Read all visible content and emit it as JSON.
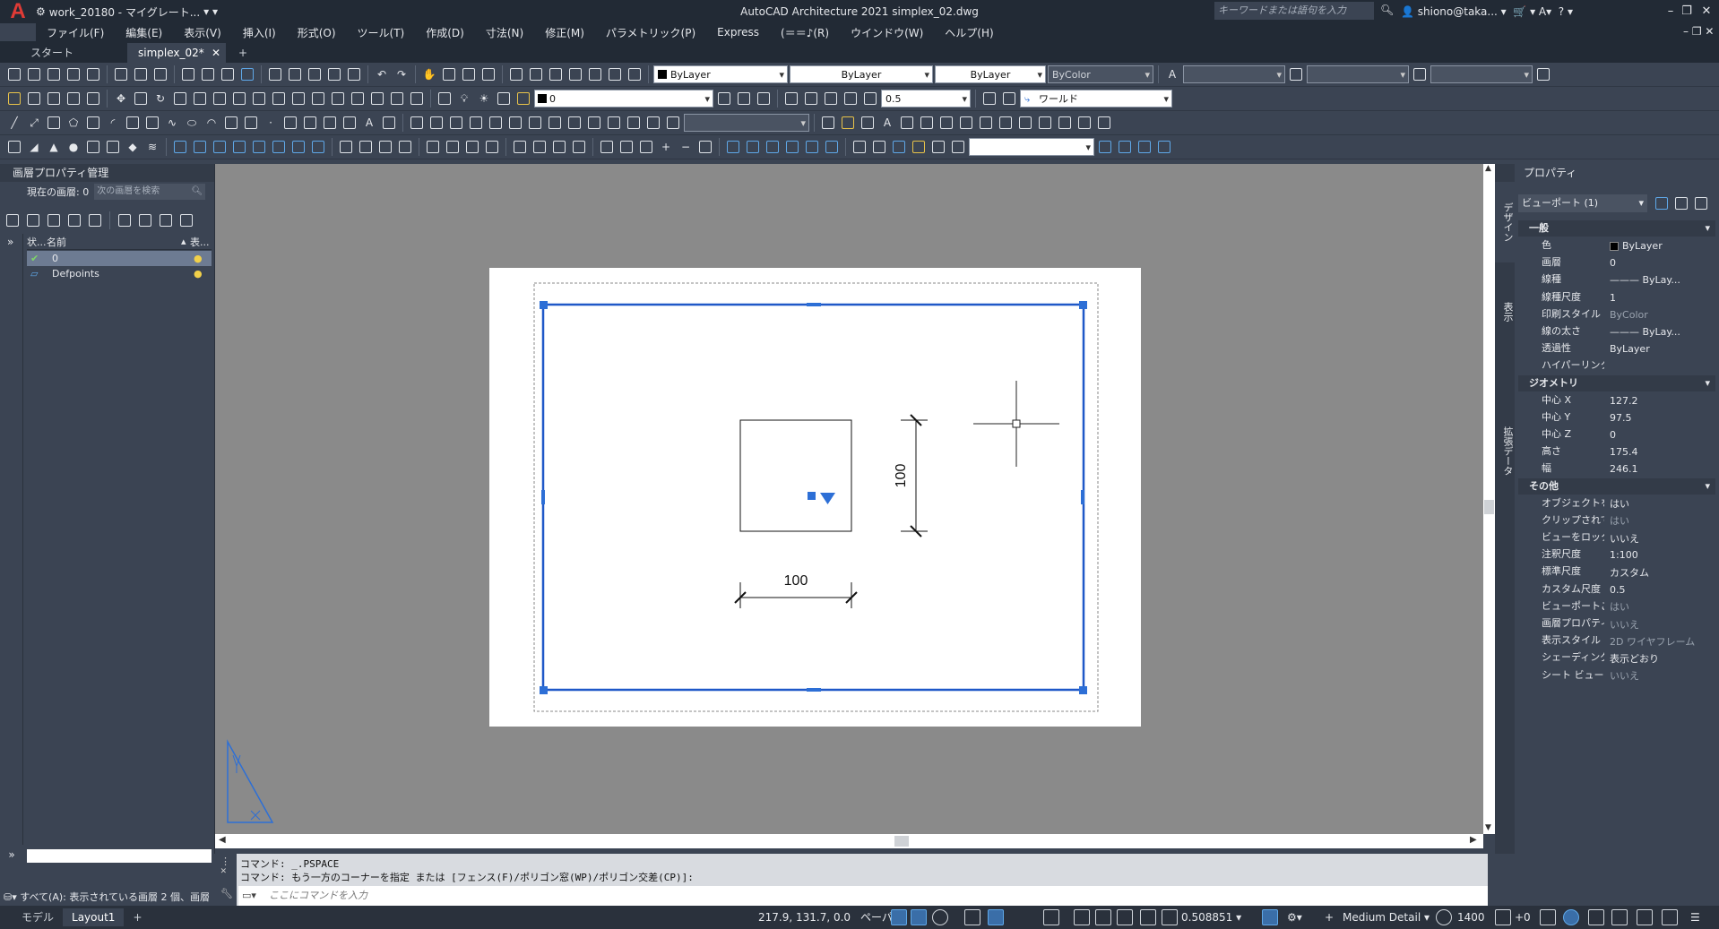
{
  "titlebar": {
    "workspace": "work_20180 - マイグレート...",
    "app_title": "AutoCAD Architecture 2021   simplex_02.dwg",
    "search_placeholder": "キーワードまたは語句を入力",
    "user": "shiono@taka..."
  },
  "menu": [
    "ファイル(F)",
    "編集(E)",
    "表示(V)",
    "挿入(I)",
    "形式(O)",
    "ツール(T)",
    "作成(D)",
    "寸法(N)",
    "修正(M)",
    "パラメトリック(P)",
    "Express",
    "(＝＝♪(R)",
    "ウインドウ(W)",
    "ヘルプ(H)"
  ],
  "tabs": {
    "start": "スタート",
    "doc": "simplex_02*",
    "add": "+"
  },
  "toolbar": {
    "color_combo": "ByLayer",
    "linetype_combo": "ByLayer",
    "lineweight_combo": "ByLayer",
    "plotstyle_combo": "ByColor",
    "layer_combo": "0",
    "scale_combo": "0.5",
    "ucs_combo": "ワールド"
  },
  "layer_panel": {
    "title": "画層プロパティ管理",
    "current_label": "現在の画層: 0",
    "search_placeholder": "次の画層を検索",
    "col_status": "状...",
    "col_name": "名前",
    "col_display": "表...",
    "layers": [
      {
        "name": "0"
      },
      {
        "name": "Defpoints"
      }
    ],
    "filter_status": "すべて(A): 表示されている画層 2 個、画層"
  },
  "drawing": {
    "dim_horizontal": "100",
    "dim_vertical": "100"
  },
  "properties": {
    "title": "プロパティ",
    "selection": "ビューポート (1)",
    "side_tabs": [
      "デザイン",
      "表示",
      "拡張データ"
    ],
    "sections": [
      {
        "title": "一般",
        "rows": [
          {
            "k": "色",
            "v": "ByLayer",
            "swatch": true
          },
          {
            "k": "画層",
            "v": "0"
          },
          {
            "k": "線種",
            "v": "——— ByLay..."
          },
          {
            "k": "線種尺度",
            "v": "1"
          },
          {
            "k": "印刷スタイル",
            "v": "ByColor",
            "dim": true
          },
          {
            "k": "線の太さ",
            "v": "——— ByLay..."
          },
          {
            "k": "透過性",
            "v": "ByLayer"
          },
          {
            "k": "ハイパーリンク",
            "v": ""
          }
        ]
      },
      {
        "title": "ジオメトリ",
        "rows": [
          {
            "k": "中心 X",
            "v": "127.2"
          },
          {
            "k": "中心 Y",
            "v": "97.5"
          },
          {
            "k": "中心 Z",
            "v": "0"
          },
          {
            "k": "高さ",
            "v": "175.4"
          },
          {
            "k": "幅",
            "v": "246.1"
          }
        ]
      },
      {
        "title": "その他",
        "rows": [
          {
            "k": "オブジェクトを表示",
            "v": "はい"
          },
          {
            "k": "クリップされている",
            "v": "はい",
            "dim": true
          },
          {
            "k": "ビューをロック",
            "v": "いいえ"
          },
          {
            "k": "注釈尺度",
            "v": "1:100"
          },
          {
            "k": "標準尺度",
            "v": "カスタム"
          },
          {
            "k": "カスタム尺度",
            "v": "0.5"
          },
          {
            "k": "ビューポートごとの...",
            "v": "はい",
            "dim": true
          },
          {
            "k": "画層プロパティの...",
            "v": "いいえ",
            "dim": true
          },
          {
            "k": "表示スタイル",
            "v": "2D ワイヤフレーム",
            "dim": true
          },
          {
            "k": "シェーディング印刷",
            "v": "表示どおり"
          },
          {
            "k": "シート ビューにリ...",
            "v": "いいえ",
            "dim": true
          }
        ]
      }
    ]
  },
  "command": {
    "line1": "コマンド: _.PSPACE",
    "line2": "コマンド: もう一方のコーナーを指定 または [フェンス(F)/ポリゴン窓(WP)/ポリゴン交差(CP)]:",
    "placeholder": "ここにコマンドを入力"
  },
  "status": {
    "model_tab": "モデル",
    "layout_tab": "Layout1",
    "coords": "217.9, 131.7, 0.0",
    "space": "ペーパー",
    "vp_scale": "0.508851",
    "detail": "Medium Detail",
    "elevation": "1400",
    "offset": "+0"
  },
  "colors": {
    "accent": "#2d6fd6",
    "bg": "#3b4453",
    "canvas": "#8a8a8a"
  }
}
